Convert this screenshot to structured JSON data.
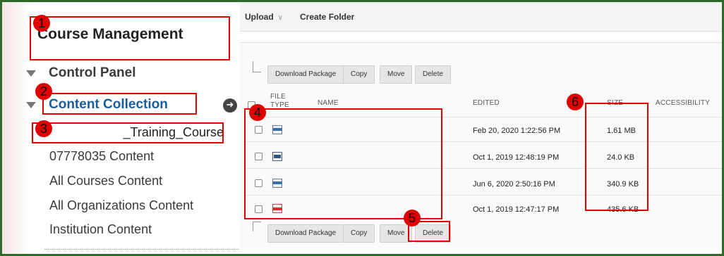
{
  "sidebar": {
    "title": "Course Management",
    "control_panel": "Control Panel",
    "content_collection": "Content Collection",
    "items": [
      "_Training_Course",
      "07778035 Content",
      "All Courses Content",
      "All Organizations Content",
      "Institution Content"
    ]
  },
  "toolbar": {
    "upload_label": "Upload",
    "upload_chevron": "∨",
    "create_folder_label": "Create Folder"
  },
  "actions": {
    "download_package": "Download Package",
    "copy": "Copy",
    "move": "Move",
    "delete": "Delete"
  },
  "table": {
    "headers": {
      "file_type": "FILE TYPE",
      "name": "NAME",
      "edited": "EDITED",
      "size": "SIZE",
      "accessibility": "ACCESSIBILITY"
    },
    "rows": [
      {
        "icon": "document-icon",
        "name": "",
        "edited": "Feb 20, 2020 1:22:56 PM",
        "size": "1.61 MB"
      },
      {
        "icon": "image-file-icon",
        "name": "",
        "edited": "Oct 1, 2019 12:48:19 PM",
        "size": "24.0 KB"
      },
      {
        "icon": "document-icon",
        "name": "",
        "edited": "Jun 6, 2020 2:50:16 PM",
        "size": "340.9 KB"
      },
      {
        "icon": "pdf-icon",
        "name": "",
        "edited": "Oct 1, 2019 12:47:17 PM",
        "size": "435.6 KB"
      }
    ]
  },
  "annotations": [
    "1",
    "2",
    "3",
    "4",
    "5",
    "6"
  ],
  "colors": {
    "annotation_red": "#e00000",
    "frame_green": "#2e6b2a",
    "link_blue": "#1c5d99"
  }
}
